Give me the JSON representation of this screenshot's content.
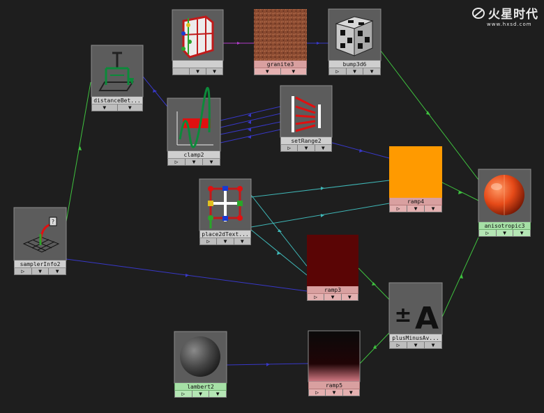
{
  "logo": {
    "text": "火星时代",
    "url": "www.hxsd.com"
  },
  "nodes": [
    {
      "id": "place3d",
      "label": "",
      "controls": [
        "",
        "▼",
        "▼"
      ]
    },
    {
      "id": "granite3",
      "label": "granite3",
      "controls": [
        "▼",
        "▼"
      ]
    },
    {
      "id": "bump3d6",
      "label": "bump3d6",
      "controls": [
        "▷",
        "▼",
        "▼"
      ]
    },
    {
      "id": "distanceBet",
      "label": "distanceBet...",
      "controls": [
        "▼",
        "▼"
      ]
    },
    {
      "id": "clamp2",
      "label": "clamp2",
      "controls": [
        "▷",
        "▼",
        "▼"
      ]
    },
    {
      "id": "setRange2",
      "label": "setRange2",
      "controls": [
        "▷",
        "▼",
        "▼"
      ]
    },
    {
      "id": "ramp4",
      "label": "ramp4",
      "controls": [
        "▷",
        "▼",
        "▼"
      ]
    },
    {
      "id": "anisotropic3",
      "label": "anisotropic3",
      "controls": [
        "▷",
        "▼",
        "▼"
      ]
    },
    {
      "id": "place2dText",
      "label": "place2dText...",
      "controls": [
        "▷",
        "▼",
        "▼"
      ]
    },
    {
      "id": "samplerInfo2",
      "label": "samplerInfo2",
      "controls": [
        "▷",
        "▼",
        "▼"
      ]
    },
    {
      "id": "ramp3",
      "label": "ramp3",
      "controls": [
        "▷",
        "▼",
        "▼"
      ]
    },
    {
      "id": "plusMinus",
      "label": "plusMinusAv...",
      "controls": [
        "▷",
        "▼",
        "▼"
      ]
    },
    {
      "id": "lambert2",
      "label": "lambert2",
      "controls": [
        "▷",
        "▼",
        "▼"
      ]
    },
    {
      "id": "ramp5",
      "label": "ramp5",
      "controls": [
        "▷",
        "▼",
        "▼"
      ]
    }
  ],
  "colors": {
    "background": "#1e1e1e",
    "connection_blue": "#3838c8",
    "connection_green": "#3fc23f",
    "connection_cyan": "#3fb7b7",
    "connection_magenta": "#b13cc9",
    "ramp4_swatch": "#ff9a00",
    "ramp3_swatch": "#5a0505"
  }
}
